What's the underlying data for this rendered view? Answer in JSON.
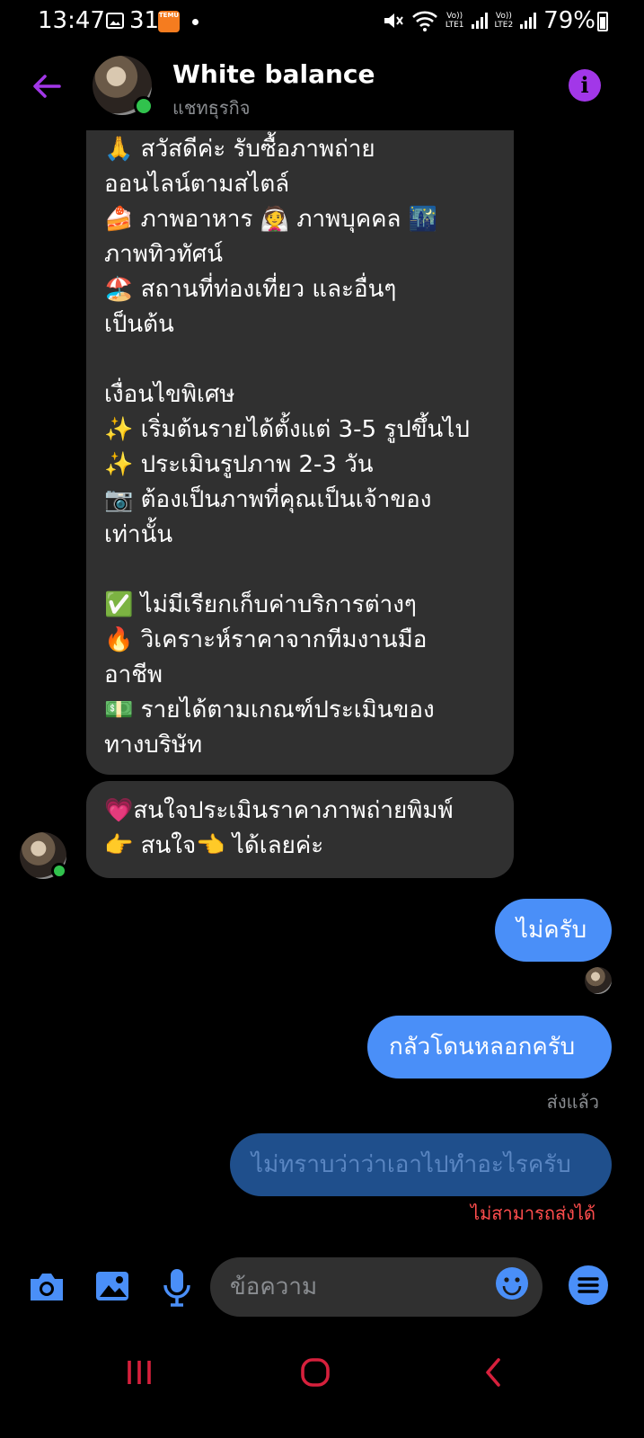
{
  "status_bar": {
    "time": "13:47",
    "temperature": "31°",
    "temu_label": "TEMU",
    "sim1_label": "LTE1",
    "sim2_label": "LTE2",
    "volte": "Vo))",
    "battery": "79%"
  },
  "header": {
    "title": "White balance",
    "subtitle": "แชทธุรกิจ"
  },
  "messages": {
    "incoming_1": {
      "lines": [
        "🙏 สวัสดีค่ะ รับซื้อภาพถ่าย",
        "ออนไลน์ตามสไตล์",
        "🍰 ภาพอาหาร 👰 ภาพบุคคล 🌃",
        "ภาพทิวทัศน์",
        "🏖️ สถานที่ท่องเที่ยว และอื่นๆ",
        "เป็นต้น",
        "",
        "เงื่อนไขพิเศษ",
        "✨ เริ่มต้นรายได้ตั้งแต่ 3-5 รูปขึ้นไป",
        "✨ ประเมินรูปภาพ 2-3 วัน",
        "📷 ต้องเป็นภาพที่คุณเป็นเจ้าของ",
        "เท่านั้น",
        "",
        "✅ ไม่มีเรียกเก็บค่าบริการต่างๆ",
        "🔥 วิเคราะห์ราคาจากทีมงานมือ",
        "อาชีพ",
        "💵 รายได้ตามเกณฑ์ประเมินของ",
        "ทางบริษัท"
      ]
    },
    "incoming_2": {
      "line1": "💗สนใจประเมินราคาภาพถ่ายพิมพ์",
      "line2": "👉 สนใจ👈 ได้เลยค่ะ"
    },
    "outgoing_1": "ไม่ครับ",
    "outgoing_2": "กลัวโดนหลอกครับ",
    "outgoing_2_status": "ส่งแล้ว",
    "outgoing_3": "ไม่ทราบว่าว่าเอาไปทำอะไรครับ",
    "outgoing_3_status": "ไม่สามารถส่งได้"
  },
  "composer": {
    "placeholder": "ข้อความ"
  },
  "colors": {
    "accent_purple": "#a237e8",
    "outgoing_bubble": "#4a8ff8",
    "failed_bubble": "#1f4f8c",
    "incoming_bubble": "#303030",
    "error_text": "#ff4d4d",
    "nav_red": "#d6203c"
  }
}
